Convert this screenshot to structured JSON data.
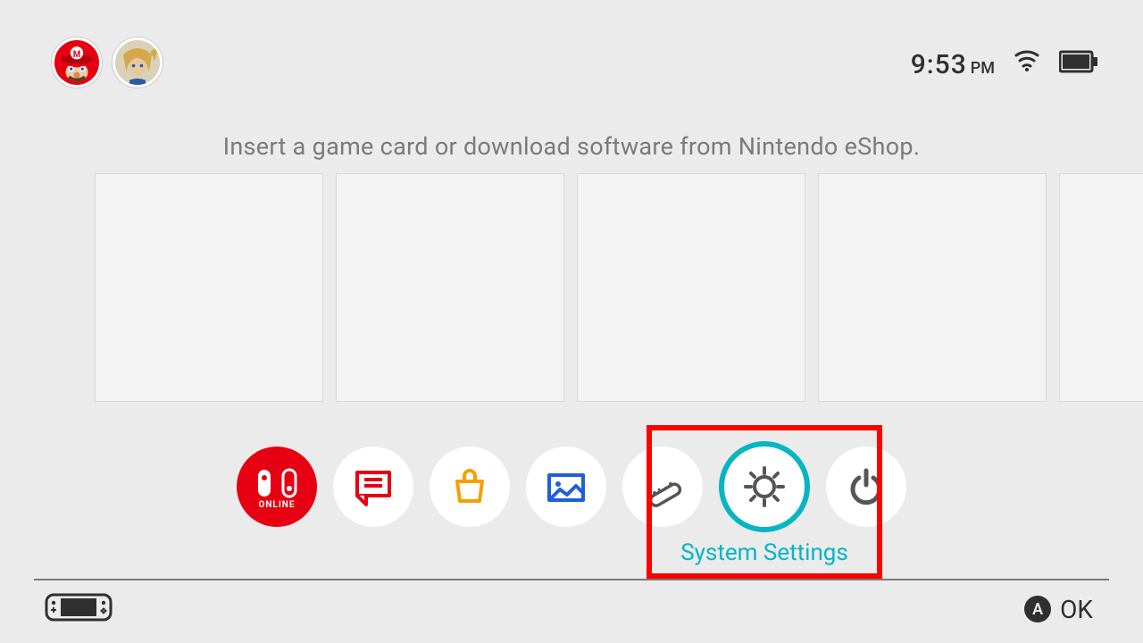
{
  "topbar": {
    "avatars": [
      {
        "name": "mario"
      },
      {
        "name": "link"
      }
    ],
    "clock": {
      "time": "9:53",
      "ampm": "PM"
    }
  },
  "prompt": "Insert a game card or download software from Nintendo eShop.",
  "tiles": {
    "count": 5
  },
  "dock": {
    "items": [
      {
        "id": "online",
        "label": "Nintendo Switch Online",
        "sublabel": "ONLINE"
      },
      {
        "id": "news",
        "label": "News"
      },
      {
        "id": "eshop",
        "label": "Nintendo eShop"
      },
      {
        "id": "album",
        "label": "Album"
      },
      {
        "id": "controllers",
        "label": "Controllers"
      },
      {
        "id": "settings",
        "label": "System Settings"
      },
      {
        "id": "power",
        "label": "Sleep Mode"
      }
    ],
    "selectedIndex": 5
  },
  "footer": {
    "hint_button": "A",
    "hint_label": "OK"
  },
  "colors": {
    "bg": "#ebebeb",
    "accent": "#07b5c3",
    "nintendo_red": "#e60012",
    "annotation_red": "#ff0000"
  }
}
